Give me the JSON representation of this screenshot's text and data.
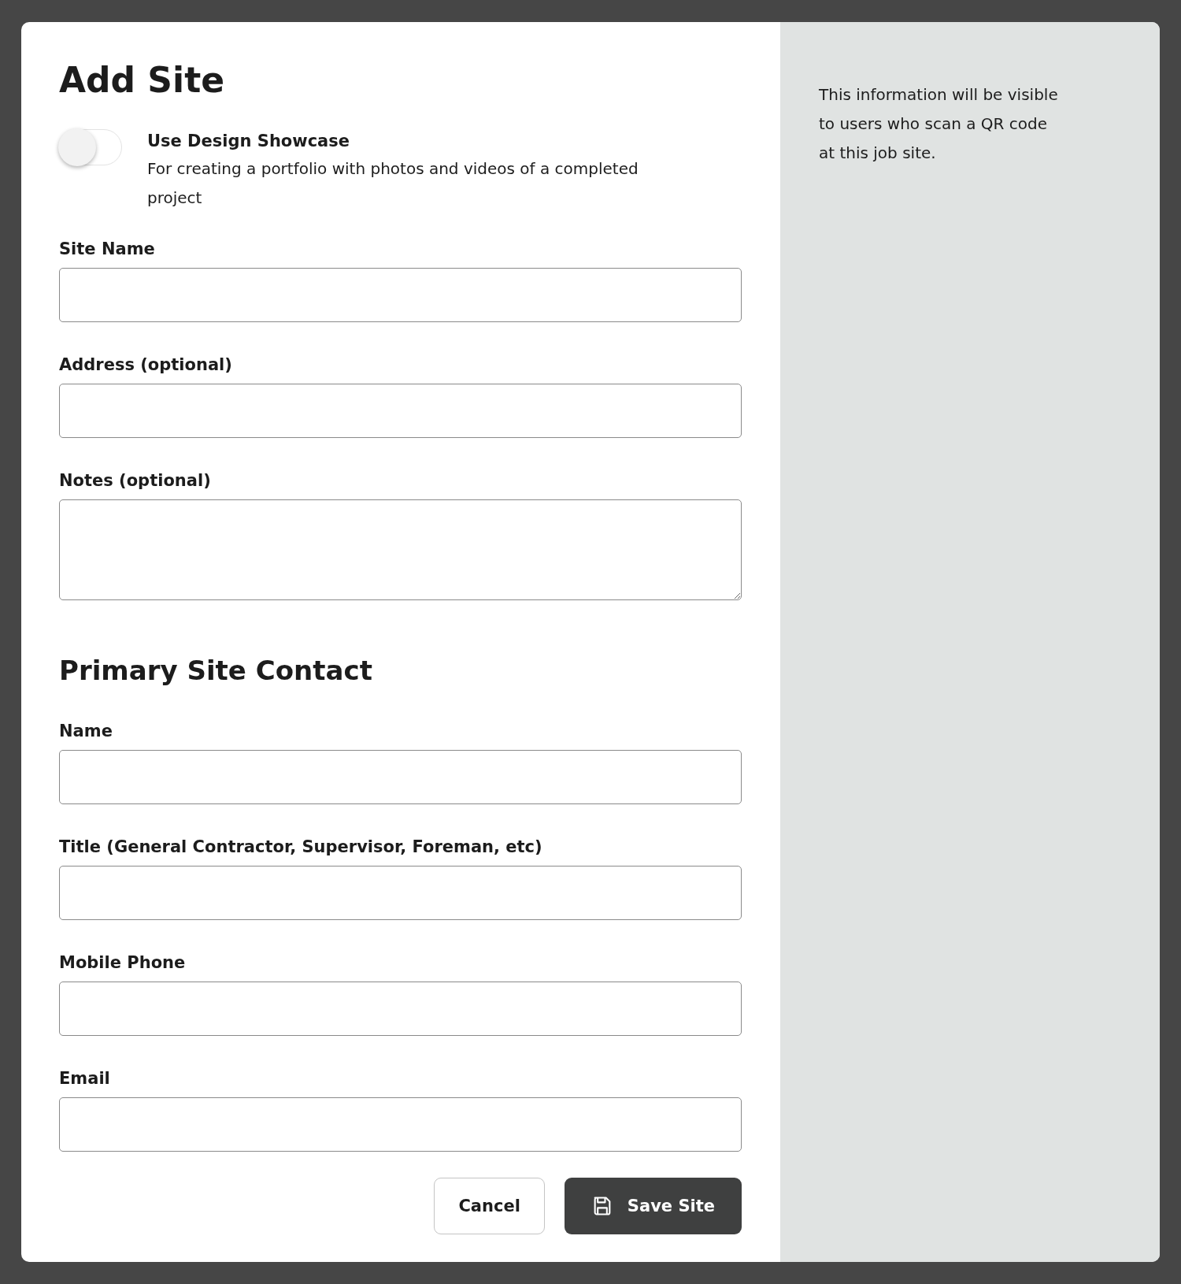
{
  "title": "Add Site",
  "toggle": {
    "label": "Use Design Showcase",
    "description": "For creating a portfolio with photos and videos of a completed project",
    "on": false
  },
  "site_fields": [
    {
      "label": "Site Name",
      "kind": "input"
    },
    {
      "label": "Address (optional)",
      "kind": "input"
    },
    {
      "label": "Notes (optional)",
      "kind": "textarea"
    }
  ],
  "contact_section": {
    "heading": "Primary Site Contact",
    "fields": [
      {
        "label": "Name",
        "kind": "input"
      },
      {
        "label": "Title (General Contractor, Supervisor, Foreman, etc)",
        "kind": "input"
      },
      {
        "label": "Mobile Phone",
        "kind": "input"
      },
      {
        "label": "Email",
        "kind": "input"
      }
    ]
  },
  "buttons": [
    {
      "label": "Cancel",
      "kind": "secondary"
    },
    {
      "label": "Save Site",
      "kind": "primary"
    }
  ],
  "info_text": "This information will be visible to users who scan a QR code at this job site."
}
